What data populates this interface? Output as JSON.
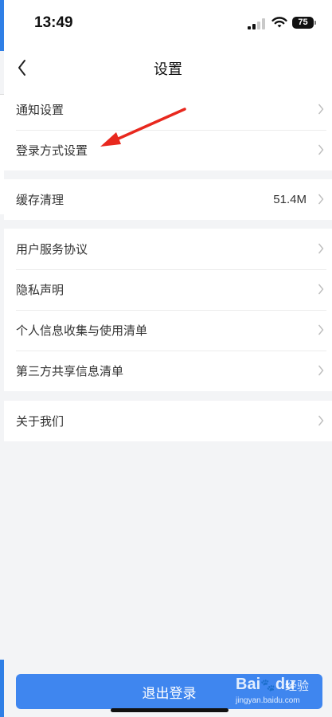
{
  "status_bar": {
    "time": "13:49",
    "battery": "75"
  },
  "nav": {
    "title": "设置"
  },
  "groups": [
    {
      "items": [
        {
          "label": "通知设置"
        },
        {
          "label": "登录方式设置"
        }
      ]
    },
    {
      "items": [
        {
          "label": "缓存清理",
          "value": "51.4M"
        }
      ]
    },
    {
      "items": [
        {
          "label": "用户服务协议"
        },
        {
          "label": "隐私声明"
        },
        {
          "label": "个人信息收集与使用清单"
        },
        {
          "label": "第三方共享信息清单"
        }
      ]
    },
    {
      "items": [
        {
          "label": "关于我们"
        }
      ]
    }
  ],
  "logout": {
    "label": "退出登录"
  },
  "watermark": {
    "brand": "Bai",
    "brand_suffix": "du",
    "cn": "经验",
    "url": "jingyan.baidu.com"
  },
  "colors": {
    "accent": "#3f86ef",
    "annotation_arrow": "#e8281e",
    "background": "#f3f4f6"
  }
}
